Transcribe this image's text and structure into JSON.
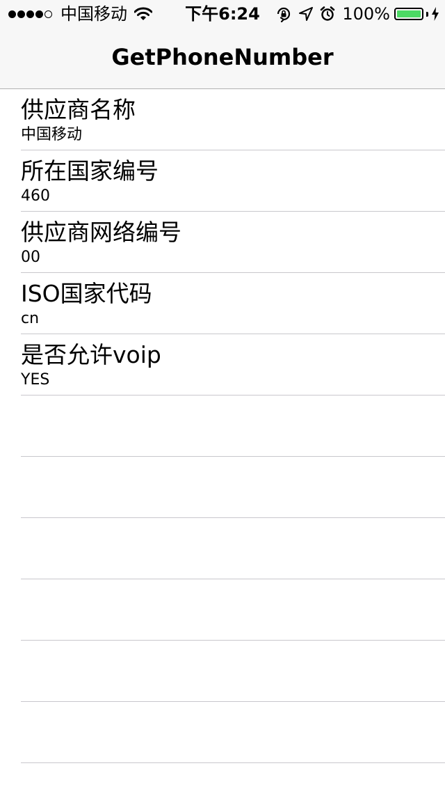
{
  "status_bar": {
    "carrier": "中国移动",
    "time": "下午6:24",
    "battery_percent": "100%",
    "battery_level": 1.0,
    "battery_color": "#4cd964",
    "signal_strength": 4,
    "signal_max": 5,
    "icons": [
      "wifi-icon",
      "rotation-lock-icon",
      "location-arrow-icon",
      "alarm-icon",
      "charging-bolt-icon"
    ]
  },
  "nav": {
    "title": "GetPhoneNumber"
  },
  "table": {
    "rows": [
      {
        "title": "供应商名称",
        "detail": "中国移动"
      },
      {
        "title": "所在国家编号",
        "detail": "460"
      },
      {
        "title": "供应商网络编号",
        "detail": "00"
      },
      {
        "title": "ISO国家代码",
        "detail": "cn"
      },
      {
        "title": "是否允许voip",
        "detail": "YES"
      }
    ],
    "empty_rows": 6
  }
}
